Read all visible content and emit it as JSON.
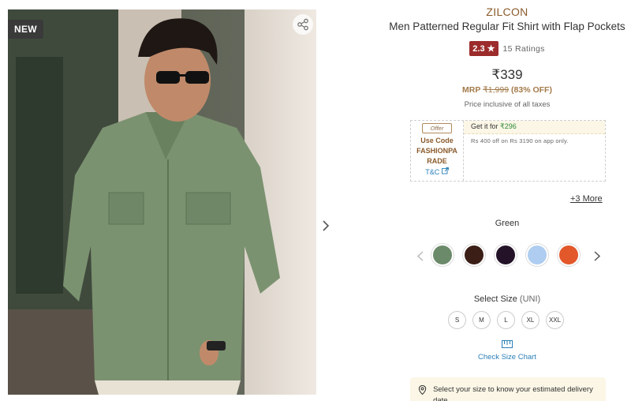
{
  "gallery": {
    "badge": "NEW",
    "share_icon": "share-icon",
    "next_icon": "chevron-right-icon",
    "image_desc": "model-photo"
  },
  "product": {
    "brand": "ZILCON",
    "title": "Men Patterned Regular Fit Shirt with Flap Pockets",
    "rating": "2.3 ★",
    "rating_count": "15 Ratings",
    "price": "₹339",
    "mrp_prefix": "MRP",
    "mrp_value": "₹1,999",
    "discount": "(83% OFF)",
    "tax_note": "Price inclusive of all taxes"
  },
  "offer": {
    "tag": "Offer",
    "code_lines": [
      "Use Code",
      "FASHIONPA",
      "RADE"
    ],
    "tc": "T&C",
    "head_prefix": "Get it for",
    "head_amount": "₹296",
    "description": "Rs 400 off on Rs 3190 on app only.",
    "more": "+3 More"
  },
  "colors": {
    "selected_label": "Green",
    "swatches": [
      {
        "name": "green",
        "hex": "#6b8a6a"
      },
      {
        "name": "brown",
        "hex": "#3b1f16"
      },
      {
        "name": "dark-purple",
        "hex": "#241328"
      },
      {
        "name": "light-blue",
        "hex": "#aecdf0"
      },
      {
        "name": "orange",
        "hex": "#e2582a"
      }
    ]
  },
  "sizes": {
    "label": "Select Size",
    "unit": "(UNI)",
    "options": [
      "S",
      "M",
      "L",
      "XL",
      "XXL"
    ],
    "chart_label": "Check Size Chart"
  },
  "delivery": {
    "text": "Select your size to know your estimated delivery date."
  },
  "theme": {
    "brand_color": "#8a5a2b",
    "rating_bg": "#9c2b2b",
    "link_color": "#2a7fb8",
    "offer_green": "#2e8b3a"
  }
}
